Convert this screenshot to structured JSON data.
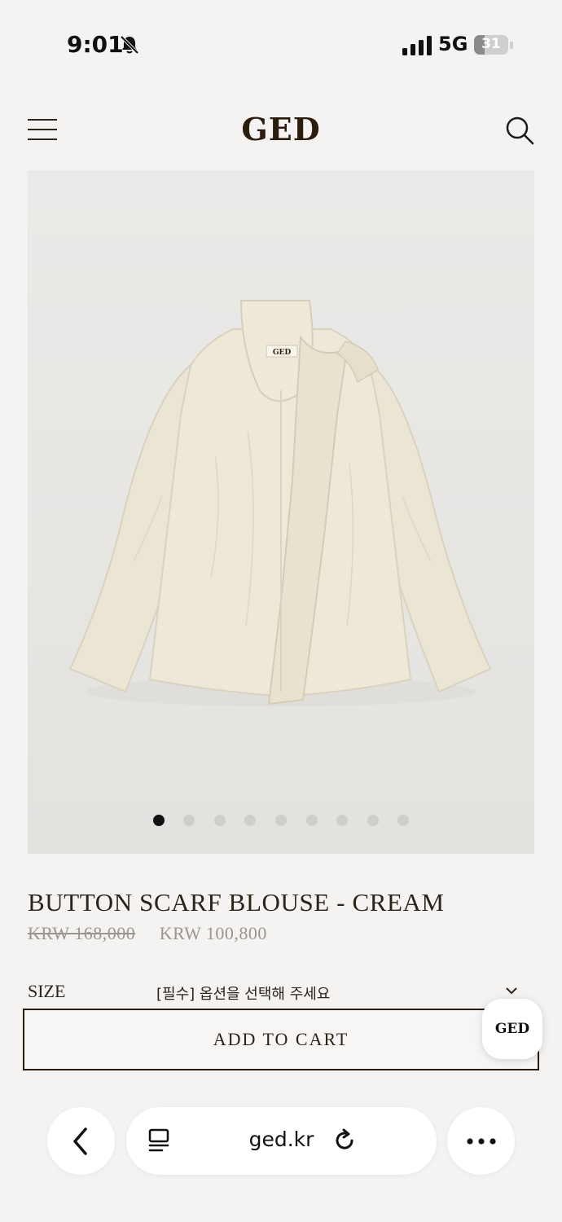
{
  "status_bar": {
    "time": "9:01",
    "network": "5G",
    "battery_level": "31",
    "battery_fraction": 0.31,
    "icons": [
      "bell-slash-icon",
      "cellular-signal-icon",
      "battery-icon"
    ]
  },
  "header": {
    "logo": "GED",
    "icons": [
      "hamburger-menu-icon",
      "search-icon"
    ]
  },
  "product": {
    "image_label": "GED",
    "carousel": {
      "total": 9,
      "active_index": 0
    },
    "title": "BUTTON SCARF BLOUSE - CREAM",
    "price_original": "KRW 168,000",
    "price_sale": "KRW 100,800",
    "option": {
      "label": "SIZE",
      "placeholder": "[필수] 옵션을 선택해 주세요"
    }
  },
  "cart": {
    "add_to_cart_label": "ADD TO CART",
    "floating_badge": "GED"
  },
  "browser": {
    "url": "ged.kr",
    "icons": [
      "back-chevron-icon",
      "reader-mode-icon",
      "reload-icon",
      "more-dots-icon"
    ]
  },
  "colors": {
    "background": "#f4f3f1",
    "brand_dark": "#2b1d0e",
    "garment": "#ece6d6",
    "muted_price": "#9a9690"
  }
}
